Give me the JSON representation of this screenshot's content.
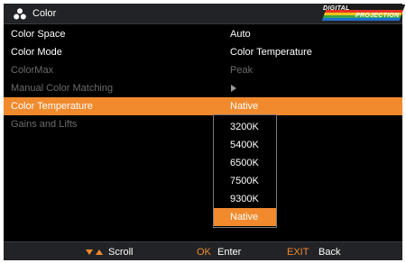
{
  "header": {
    "title": "Color",
    "icon": "color-dots-icon",
    "logo": {
      "line1": "DIGITAL",
      "line2": "PROJECTION"
    }
  },
  "menu": [
    {
      "label": "Color Space",
      "value": "Auto",
      "state": "normal"
    },
    {
      "label": "Color Mode",
      "value": "Color Temperature",
      "state": "normal"
    },
    {
      "label": "ColorMax",
      "value": "Peak",
      "state": "disabled"
    },
    {
      "label": "Manual Color Matching",
      "value": "",
      "value_icon": "submenu-arrow-icon",
      "state": "disabled"
    },
    {
      "label": "Color Temperature",
      "value": "Native",
      "state": "selected"
    },
    {
      "label": "Gains and Lifts",
      "value": "",
      "state": "disabled"
    }
  ],
  "dropdown": {
    "options": [
      "3200K",
      "5400K",
      "6500K",
      "7500K",
      "9300K",
      "Native"
    ],
    "selected": "Native"
  },
  "footer": {
    "scroll_label": "Scroll",
    "ok_key": "OK",
    "ok_label": "Enter",
    "exit_key": "EXIT",
    "exit_label": "Back"
  },
  "colors": {
    "accent": "#f18a2d",
    "bar": "#222326",
    "background": "#000000",
    "disabled_text": "#6b6b6b"
  }
}
